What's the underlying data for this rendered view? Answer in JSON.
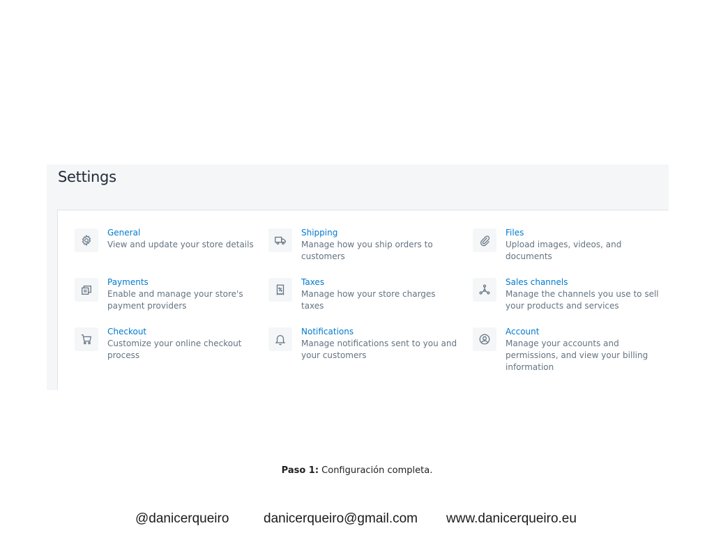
{
  "settings": {
    "title": "Settings",
    "items": [
      {
        "icon": "gear-icon",
        "title": "General",
        "desc_lines": [
          "View and update your store details"
        ]
      },
      {
        "icon": "truck-icon",
        "title": "Shipping",
        "desc_lines": [
          "Manage how you ship orders to",
          "customers"
        ]
      },
      {
        "icon": "paperclip-icon",
        "title": "Files",
        "desc_lines": [
          "Upload images, videos, and",
          "documents"
        ]
      },
      {
        "icon": "payment-icon",
        "title": "Payments",
        "desc_lines": [
          "Enable and manage your store's",
          "payment providers"
        ]
      },
      {
        "icon": "receipt-icon",
        "title": "Taxes",
        "desc_lines": [
          "Manage how your store charges",
          "taxes"
        ]
      },
      {
        "icon": "channels-icon",
        "title": "Sales channels",
        "desc_lines": [
          "Manage the channels you use to sell",
          "your products and services"
        ]
      },
      {
        "icon": "cart-icon",
        "title": "Checkout",
        "desc_lines": [
          "Customize your online checkout",
          "process"
        ]
      },
      {
        "icon": "bell-icon",
        "title": "Notifications",
        "desc_lines": [
          "Manage notifications sent to you and",
          "your customers"
        ]
      },
      {
        "icon": "user-circle-icon",
        "title": "Account",
        "desc_lines": [
          "Manage your accounts and",
          "permissions, and view your billing",
          "information"
        ]
      }
    ]
  },
  "caption": {
    "bold": "Paso 1:",
    "text": " Configuración completa."
  },
  "footer": {
    "handle": "@danicerqueiro",
    "email": "danicerqueiro@gmail.com",
    "website": "www.danicerqueiro.eu"
  }
}
